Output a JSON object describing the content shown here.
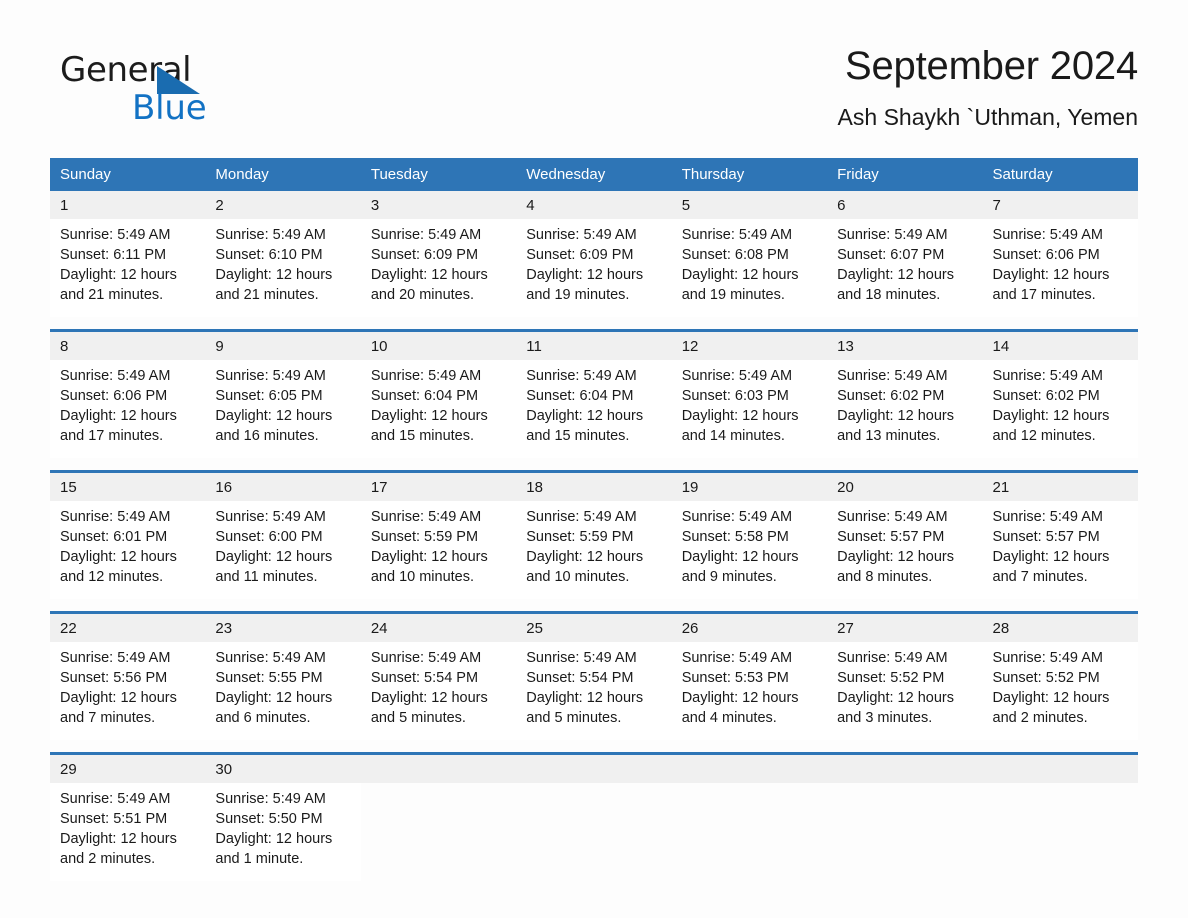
{
  "logo": {
    "text_primary": "General",
    "text_secondary": "Blue",
    "primary_color": "#1c1c1c",
    "secondary_color": "#1272c4",
    "triangle_color": "#1a6cb0"
  },
  "header": {
    "title": "September 2024",
    "subtitle": "Ash Shaykh `Uthman, Yemen"
  },
  "theme": {
    "header_band": "#2e75b6",
    "daynum_band": "#f0f0f0",
    "cell_background": "#ffffff",
    "page_background": "#fdfdfd",
    "text": "#1a1a1a"
  },
  "weekdays": [
    "Sunday",
    "Monday",
    "Tuesday",
    "Wednesday",
    "Thursday",
    "Friday",
    "Saturday"
  ],
  "weeks": [
    {
      "days": [
        {
          "num": "1",
          "sunrise": "Sunrise: 5:49 AM",
          "sunset": "Sunset: 6:11 PM",
          "daylight": "Daylight: 12 hours and 21 minutes."
        },
        {
          "num": "2",
          "sunrise": "Sunrise: 5:49 AM",
          "sunset": "Sunset: 6:10 PM",
          "daylight": "Daylight: 12 hours and 21 minutes."
        },
        {
          "num": "3",
          "sunrise": "Sunrise: 5:49 AM",
          "sunset": "Sunset: 6:09 PM",
          "daylight": "Daylight: 12 hours and 20 minutes."
        },
        {
          "num": "4",
          "sunrise": "Sunrise: 5:49 AM",
          "sunset": "Sunset: 6:09 PM",
          "daylight": "Daylight: 12 hours and 19 minutes."
        },
        {
          "num": "5",
          "sunrise": "Sunrise: 5:49 AM",
          "sunset": "Sunset: 6:08 PM",
          "daylight": "Daylight: 12 hours and 19 minutes."
        },
        {
          "num": "6",
          "sunrise": "Sunrise: 5:49 AM",
          "sunset": "Sunset: 6:07 PM",
          "daylight": "Daylight: 12 hours and 18 minutes."
        },
        {
          "num": "7",
          "sunrise": "Sunrise: 5:49 AM",
          "sunset": "Sunset: 6:06 PM",
          "daylight": "Daylight: 12 hours and 17 minutes."
        }
      ]
    },
    {
      "days": [
        {
          "num": "8",
          "sunrise": "Sunrise: 5:49 AM",
          "sunset": "Sunset: 6:06 PM",
          "daylight": "Daylight: 12 hours and 17 minutes."
        },
        {
          "num": "9",
          "sunrise": "Sunrise: 5:49 AM",
          "sunset": "Sunset: 6:05 PM",
          "daylight": "Daylight: 12 hours and 16 minutes."
        },
        {
          "num": "10",
          "sunrise": "Sunrise: 5:49 AM",
          "sunset": "Sunset: 6:04 PM",
          "daylight": "Daylight: 12 hours and 15 minutes."
        },
        {
          "num": "11",
          "sunrise": "Sunrise: 5:49 AM",
          "sunset": "Sunset: 6:04 PM",
          "daylight": "Daylight: 12 hours and 15 minutes."
        },
        {
          "num": "12",
          "sunrise": "Sunrise: 5:49 AM",
          "sunset": "Sunset: 6:03 PM",
          "daylight": "Daylight: 12 hours and 14 minutes."
        },
        {
          "num": "13",
          "sunrise": "Sunrise: 5:49 AM",
          "sunset": "Sunset: 6:02 PM",
          "daylight": "Daylight: 12 hours and 13 minutes."
        },
        {
          "num": "14",
          "sunrise": "Sunrise: 5:49 AM",
          "sunset": "Sunset: 6:02 PM",
          "daylight": "Daylight: 12 hours and 12 minutes."
        }
      ]
    },
    {
      "days": [
        {
          "num": "15",
          "sunrise": "Sunrise: 5:49 AM",
          "sunset": "Sunset: 6:01 PM",
          "daylight": "Daylight: 12 hours and 12 minutes."
        },
        {
          "num": "16",
          "sunrise": "Sunrise: 5:49 AM",
          "sunset": "Sunset: 6:00 PM",
          "daylight": "Daylight: 12 hours and 11 minutes."
        },
        {
          "num": "17",
          "sunrise": "Sunrise: 5:49 AM",
          "sunset": "Sunset: 5:59 PM",
          "daylight": "Daylight: 12 hours and 10 minutes."
        },
        {
          "num": "18",
          "sunrise": "Sunrise: 5:49 AM",
          "sunset": "Sunset: 5:59 PM",
          "daylight": "Daylight: 12 hours and 10 minutes."
        },
        {
          "num": "19",
          "sunrise": "Sunrise: 5:49 AM",
          "sunset": "Sunset: 5:58 PM",
          "daylight": "Daylight: 12 hours and 9 minutes."
        },
        {
          "num": "20",
          "sunrise": "Sunrise: 5:49 AM",
          "sunset": "Sunset: 5:57 PM",
          "daylight": "Daylight: 12 hours and 8 minutes."
        },
        {
          "num": "21",
          "sunrise": "Sunrise: 5:49 AM",
          "sunset": "Sunset: 5:57 PM",
          "daylight": "Daylight: 12 hours and 7 minutes."
        }
      ]
    },
    {
      "days": [
        {
          "num": "22",
          "sunrise": "Sunrise: 5:49 AM",
          "sunset": "Sunset: 5:56 PM",
          "daylight": "Daylight: 12 hours and 7 minutes."
        },
        {
          "num": "23",
          "sunrise": "Sunrise: 5:49 AM",
          "sunset": "Sunset: 5:55 PM",
          "daylight": "Daylight: 12 hours and 6 minutes."
        },
        {
          "num": "24",
          "sunrise": "Sunrise: 5:49 AM",
          "sunset": "Sunset: 5:54 PM",
          "daylight": "Daylight: 12 hours and 5 minutes."
        },
        {
          "num": "25",
          "sunrise": "Sunrise: 5:49 AM",
          "sunset": "Sunset: 5:54 PM",
          "daylight": "Daylight: 12 hours and 5 minutes."
        },
        {
          "num": "26",
          "sunrise": "Sunrise: 5:49 AM",
          "sunset": "Sunset: 5:53 PM",
          "daylight": "Daylight: 12 hours and 4 minutes."
        },
        {
          "num": "27",
          "sunrise": "Sunrise: 5:49 AM",
          "sunset": "Sunset: 5:52 PM",
          "daylight": "Daylight: 12 hours and 3 minutes."
        },
        {
          "num": "28",
          "sunrise": "Sunrise: 5:49 AM",
          "sunset": "Sunset: 5:52 PM",
          "daylight": "Daylight: 12 hours and 2 minutes."
        }
      ]
    },
    {
      "days": [
        {
          "num": "29",
          "sunrise": "Sunrise: 5:49 AM",
          "sunset": "Sunset: 5:51 PM",
          "daylight": "Daylight: 12 hours and 2 minutes."
        },
        {
          "num": "30",
          "sunrise": "Sunrise: 5:49 AM",
          "sunset": "Sunset: 5:50 PM",
          "daylight": "Daylight: 12 hours and 1 minute."
        },
        {
          "num": "",
          "sunrise": "",
          "sunset": "",
          "daylight": ""
        },
        {
          "num": "",
          "sunrise": "",
          "sunset": "",
          "daylight": ""
        },
        {
          "num": "",
          "sunrise": "",
          "sunset": "",
          "daylight": ""
        },
        {
          "num": "",
          "sunrise": "",
          "sunset": "",
          "daylight": ""
        },
        {
          "num": "",
          "sunrise": "",
          "sunset": "",
          "daylight": ""
        }
      ]
    }
  ]
}
